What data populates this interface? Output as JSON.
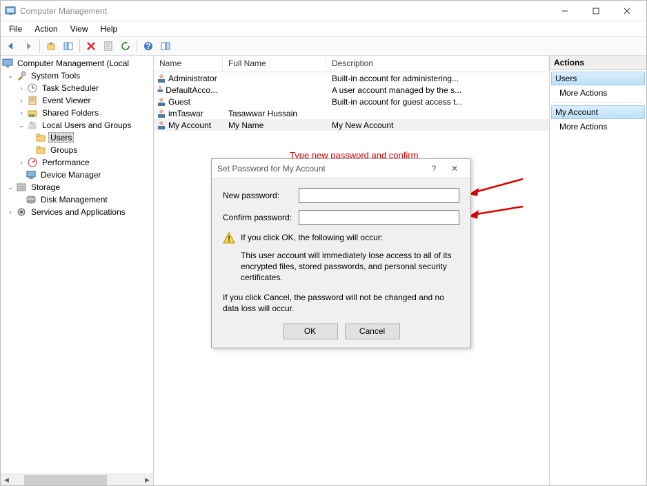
{
  "window": {
    "title": "Computer Management"
  },
  "menubar": [
    "File",
    "Action",
    "View",
    "Help"
  ],
  "tree": {
    "root": "Computer Management (Local",
    "systools": "System Tools",
    "tasksched": "Task Scheduler",
    "eventvwr": "Event Viewer",
    "shared": "Shared Folders",
    "lug": "Local Users and Groups",
    "users": "Users",
    "groups": "Groups",
    "perf": "Performance",
    "devmgr": "Device Manager",
    "storage": "Storage",
    "diskmgmt": "Disk Management",
    "svcapps": "Services and Applications"
  },
  "list": {
    "headers": {
      "name": "Name",
      "fullname": "Full Name",
      "desc": "Description"
    },
    "rows": [
      {
        "name": "Administrator",
        "fullname": "",
        "desc": "Built-in account for administering..."
      },
      {
        "name": "DefaultAcco...",
        "fullname": "",
        "desc": "A user account managed by the s..."
      },
      {
        "name": "Guest",
        "fullname": "",
        "desc": "Built-in account for guest access t..."
      },
      {
        "name": "imTaswar",
        "fullname": "Tasawwar Hussain",
        "desc": ""
      },
      {
        "name": "My Account",
        "fullname": "My Name",
        "desc": "My New Account"
      }
    ]
  },
  "actions": {
    "title": "Actions",
    "section1": "Users",
    "more1": "More Actions",
    "section2": "My Account",
    "more2": "More Actions"
  },
  "annotation": "Type new password and confirm",
  "dialog": {
    "title": "Set Password for My Account",
    "newpwd": "New password:",
    "confpwd": "Confirm password:",
    "warn1": "If you click OK, the following will occur:",
    "warn2": "This user account will immediately lose access to all of its encrypted files, stored passwords, and personal security certificates.",
    "cancelnote": "If you click Cancel, the password will not be changed and no data loss will occur.",
    "ok": "OK",
    "cancel": "Cancel"
  }
}
